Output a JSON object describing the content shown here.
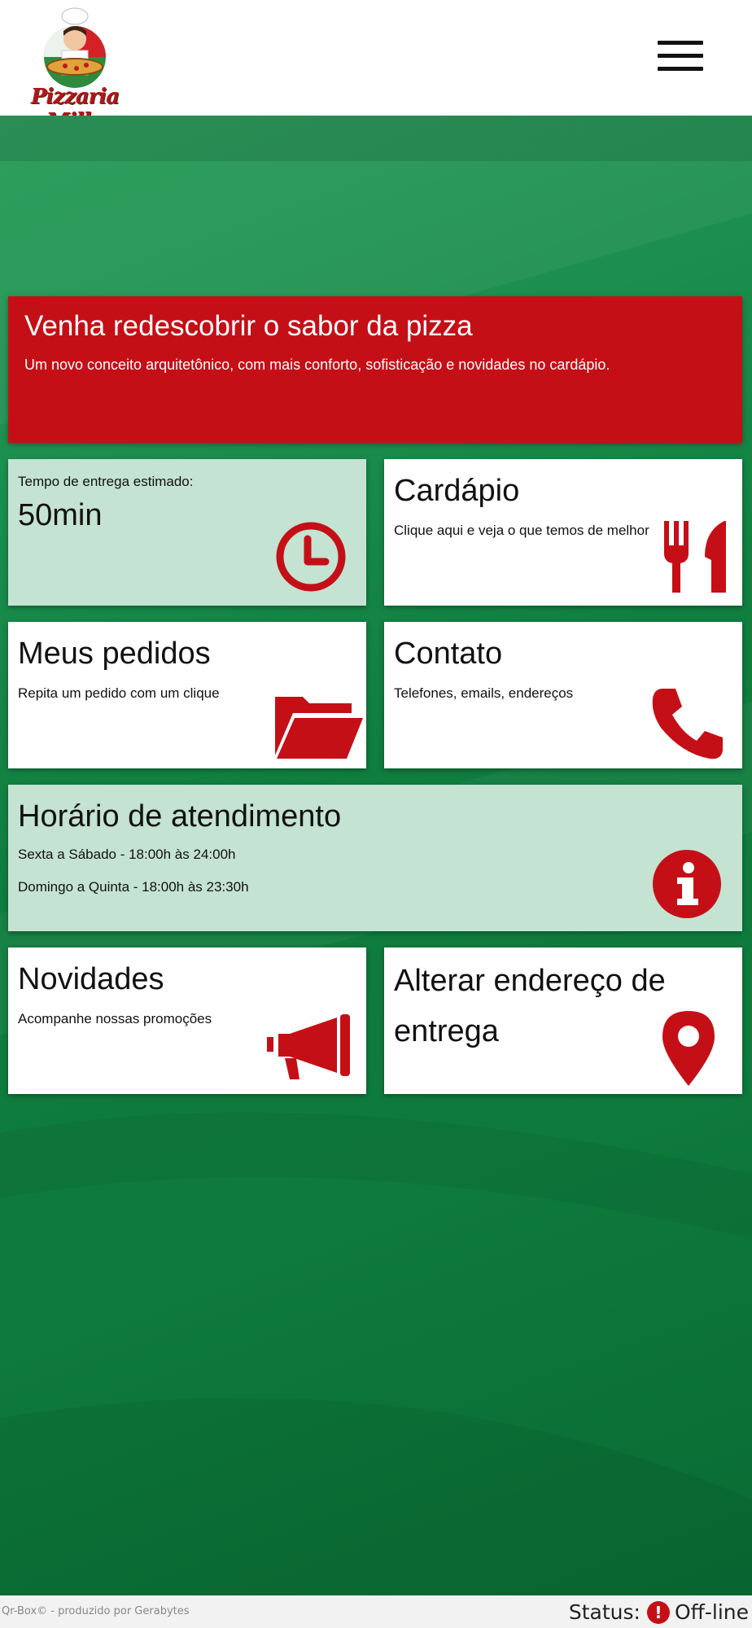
{
  "header": {
    "logo_text": "Pizzaria Milla",
    "menu_icon": "hamburger-menu-icon"
  },
  "hero": {
    "title": "Venha redescobrir o sabor da pizza",
    "subtitle": "Um novo conceito arquitetônico, com mais conforto, sofisticação e novidades no cardápio."
  },
  "cards": {
    "delivery": {
      "label": "Tempo de entrega estimado:",
      "value": "50min",
      "icon": "clock-icon"
    },
    "menu": {
      "title": "Cardápio",
      "desc": "Clique aqui e veja o que temos de melhor",
      "icon": "cutlery-icon"
    },
    "orders": {
      "title": "Meus pedidos",
      "desc": "Repita um pedido com um clique",
      "icon": "folder-open-icon"
    },
    "contact": {
      "title": "Contato",
      "desc": "Telefones, emails, endereços",
      "icon": "phone-icon"
    },
    "hours": {
      "title": "Horário de atendimento",
      "line1": "Sexta a Sábado - 18:00h às 24:00h",
      "line2": "Domingo a Quinta - 18:00h às 23:30h",
      "icon": "info-icon"
    },
    "news": {
      "title": "Novidades",
      "desc": "Acompanhe nossas promoções",
      "icon": "megaphone-icon"
    },
    "address": {
      "title": "Alterar endereço de entrega",
      "icon": "map-marker-icon"
    }
  },
  "footer": {
    "credit": "Qr-Box© - produzido por Gerabytes",
    "status_label": "Status:",
    "status_icon_glyph": "!",
    "status_value": "Off-line"
  },
  "colors": {
    "accent_red": "#c50f17",
    "mint": "#c4e3d2",
    "green": "#0e7a3c"
  }
}
